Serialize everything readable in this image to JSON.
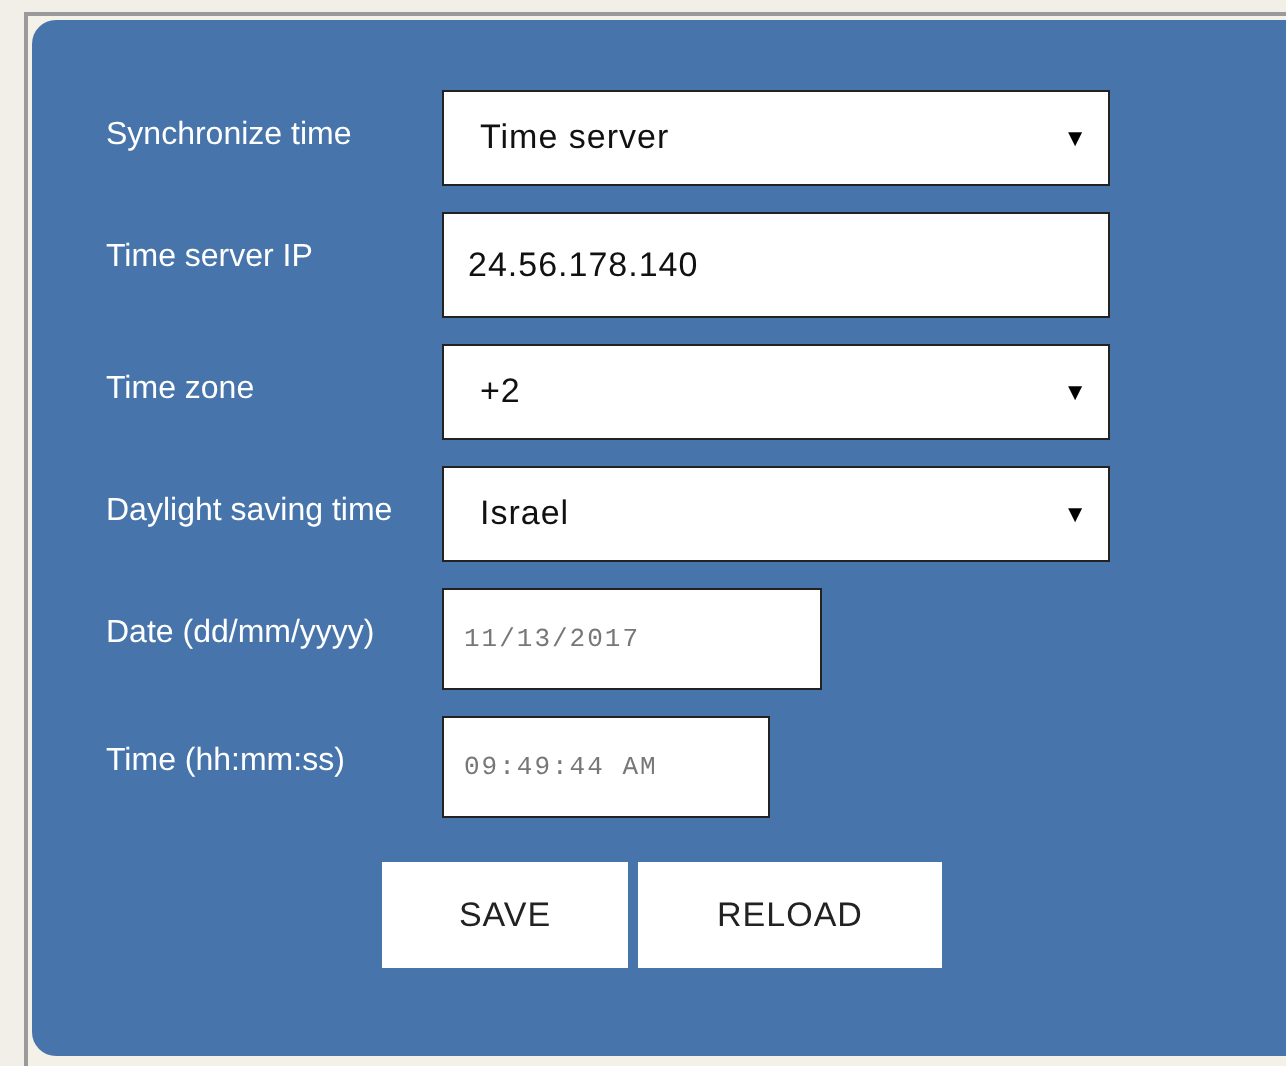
{
  "fields": [
    {
      "label": "Synchronize time",
      "kind": "select",
      "value": "Time server"
    },
    {
      "label": "Time server IP",
      "kind": "text",
      "value": "24.56.178.140"
    },
    {
      "label": "Time zone",
      "kind": "select",
      "value": "+2"
    },
    {
      "label": "Daylight saving time",
      "kind": "select",
      "value": "Israel"
    },
    {
      "label": "Date (dd/mm/yyyy)",
      "kind": "date",
      "value": "11/13/2017"
    },
    {
      "label": "Time (hh:mm:ss)",
      "kind": "time",
      "value": "09:49:44 AM"
    }
  ],
  "buttons": [
    "SAVE",
    "RELOAD"
  ],
  "dropdown_arrow": "▼"
}
